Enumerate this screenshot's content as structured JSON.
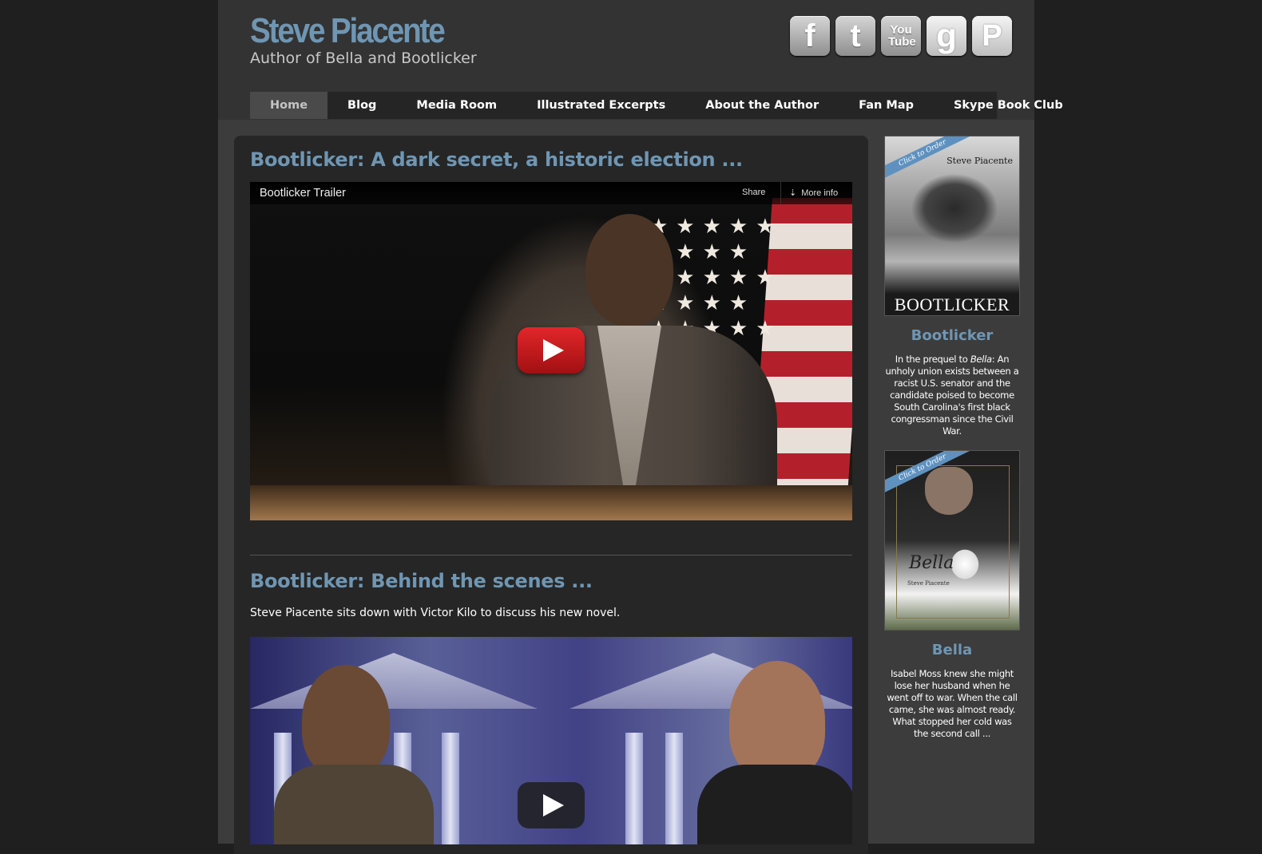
{
  "site": {
    "title": "Steve Piacente",
    "subtitle": "Author of Bella and Bootlicker"
  },
  "social": [
    {
      "name": "facebook-icon",
      "label": "f"
    },
    {
      "name": "twitter-icon",
      "label": "t"
    },
    {
      "name": "youtube-icon",
      "label": "You Tube"
    },
    {
      "name": "goodreads-icon",
      "label": "g"
    },
    {
      "name": "pinterest-icon",
      "label": "P"
    }
  ],
  "nav": [
    {
      "label": "Home",
      "active": true
    },
    {
      "label": "Blog"
    },
    {
      "label": "Media Room"
    },
    {
      "label": "Illustrated Excerpts"
    },
    {
      "label": "About the Author"
    },
    {
      "label": "Fan Map"
    },
    {
      "label": "Skype Book Club"
    }
  ],
  "posts": [
    {
      "title": "Bootlicker: A dark secret, a historic election ...",
      "video": {
        "title": "Bootlicker Trailer",
        "share_label": "Share",
        "more_label": "More info"
      }
    },
    {
      "title": "Bootlicker: Behind the scenes ...",
      "text": "Steve Piacente sits down with Victor Kilo to discuss his new novel."
    }
  ],
  "sidebar": {
    "books": [
      {
        "ribbon": "Click to Order",
        "cover_author": "Steve Piacente",
        "cover_title": "BOOTLICKER",
        "title": "Bootlicker",
        "desc_before": "In the prequel to ",
        "desc_em": "Bella",
        "desc_after": ": An unholy union exists between a racist U.S. senator and the candidate poised to become South Carolina's first black congressman since the Civil War."
      },
      {
        "ribbon": "Click to Order",
        "cover_title": "Bella",
        "cover_author": "Steve Piacente",
        "title": "Bella",
        "desc": "Isabel Moss knew she might lose her husband when he went off to war. When the call came, she was almost ready. What stopped her cold was the second call ..."
      }
    ]
  },
  "colors": {
    "accent": "#6f96b3",
    "youtube_red": "#e2262a"
  }
}
